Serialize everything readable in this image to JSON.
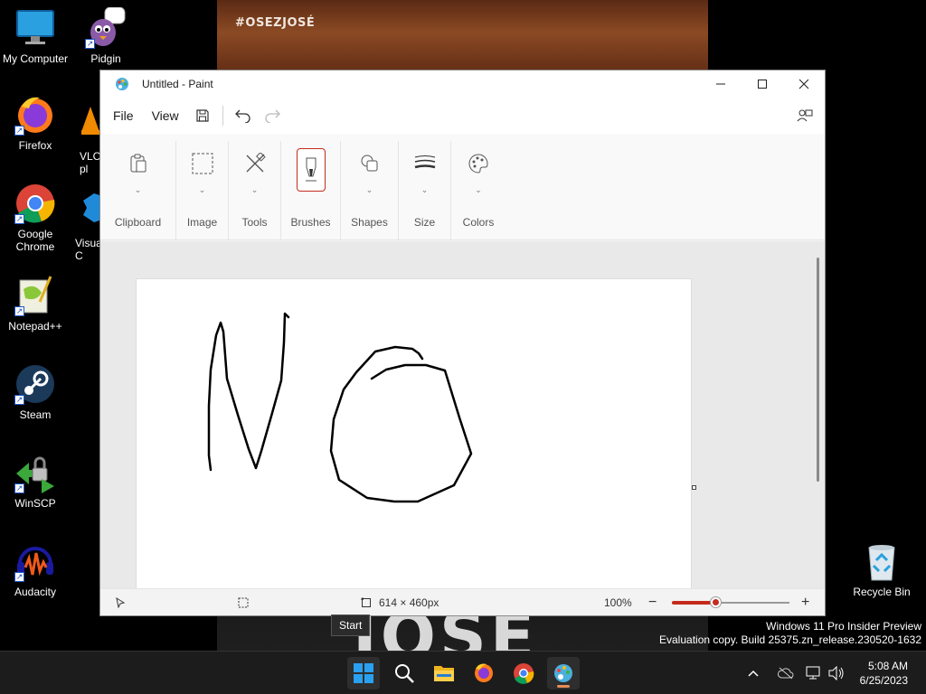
{
  "wallpaper": {
    "tag": "#OSEZJOSÉ",
    "big_text": "JOSÉ"
  },
  "desktop": {
    "icons": [
      {
        "label": "My Computer"
      },
      {
        "label": "Pidgin"
      },
      {
        "label": "Firefox"
      },
      {
        "label": "VLC media player",
        "partial": "VLC\npl"
      },
      {
        "label": "Google Chrome"
      },
      {
        "label": "Visual Studio Code",
        "partial": "Visua\nC"
      },
      {
        "label": "Notepad++"
      },
      {
        "label": "Steam"
      },
      {
        "label": "WinSCP"
      },
      {
        "label": "Audacity"
      },
      {
        "label": "Recycle Bin"
      }
    ]
  },
  "paint": {
    "title": "Untitled - Paint",
    "menu": {
      "file": "File",
      "view": "View"
    },
    "ribbon": {
      "groups": [
        {
          "label": "Clipboard",
          "icon": "clipboard-icon"
        },
        {
          "label": "Image",
          "icon": "selection-icon"
        },
        {
          "label": "Tools",
          "icon": "tools-icon"
        },
        {
          "label": "Brushes",
          "icon": "brush-icon"
        },
        {
          "label": "Shapes",
          "icon": "shapes-icon"
        },
        {
          "label": "Size",
          "icon": "size-icon"
        },
        {
          "label": "Colors",
          "icon": "palette-icon"
        }
      ]
    },
    "status": {
      "canvas_size": "614 × 460px",
      "zoom": "100%",
      "zoom_fraction": 0.38
    },
    "accent_color": "#c42b1c"
  },
  "tooltip": {
    "text": "Start"
  },
  "watermark": {
    "line1": "Windows 11 Pro Insider Preview",
    "line2": "Evaluation copy. Build 25375.zn_release.230520-1632"
  },
  "taskbar": {
    "clock": {
      "time": "5:08 AM",
      "date": "6/25/2023"
    }
  }
}
